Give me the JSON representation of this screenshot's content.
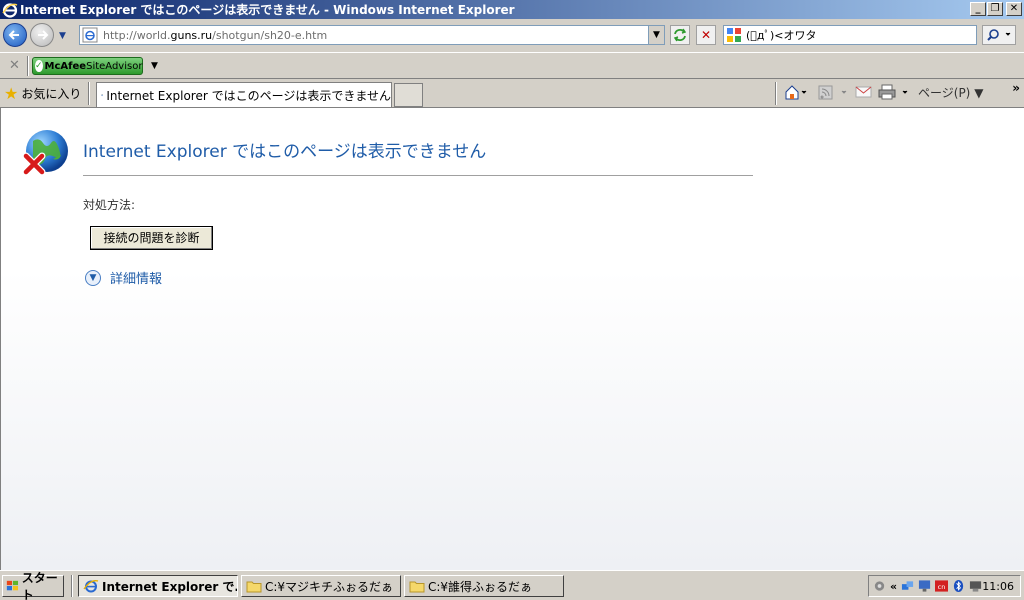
{
  "window": {
    "title": "Internet Explorer ではこのページは表示できません - Windows Internet Explorer",
    "buttons": [
      "_",
      "❐",
      "✕"
    ]
  },
  "address_bar": {
    "url_prefix": "http://world.",
    "url_domain": "guns.ru",
    "url_path": "/shotgun/sh20-e.htm"
  },
  "search": {
    "query": "(ﾟдﾟ)<オワタ"
  },
  "toolbar": {
    "close_symbol": "✕",
    "mcafee_brand": "McAfee",
    "mcafee_product": "SiteAdvisor",
    "favorites_label": "お気に入り",
    "page_menu_label": "ページ(P)",
    "overflow": "»"
  },
  "tabs": [
    {
      "label": "Internet Explorer ではこのページは表示できません",
      "active": true
    }
  ],
  "content": {
    "error_title": "Internet Explorer ではこのページは表示できません",
    "howto_label": "対処方法:",
    "diagnose_button": "接続の問題を診断",
    "more_info_label": "詳細情報"
  },
  "taskbar": {
    "start_label": "スタート",
    "tasks": [
      {
        "label": "Internet Explorer で...",
        "icon": "ie-icon",
        "active": true
      },
      {
        "label": "C:¥マジキチふぉるだぁ",
        "icon": "folder-icon",
        "active": false
      },
      {
        "label": "C:¥誰得ふぉるだぁ",
        "icon": "folder-icon",
        "active": false
      }
    ],
    "tray_expand": "«",
    "clock": "11:06"
  }
}
